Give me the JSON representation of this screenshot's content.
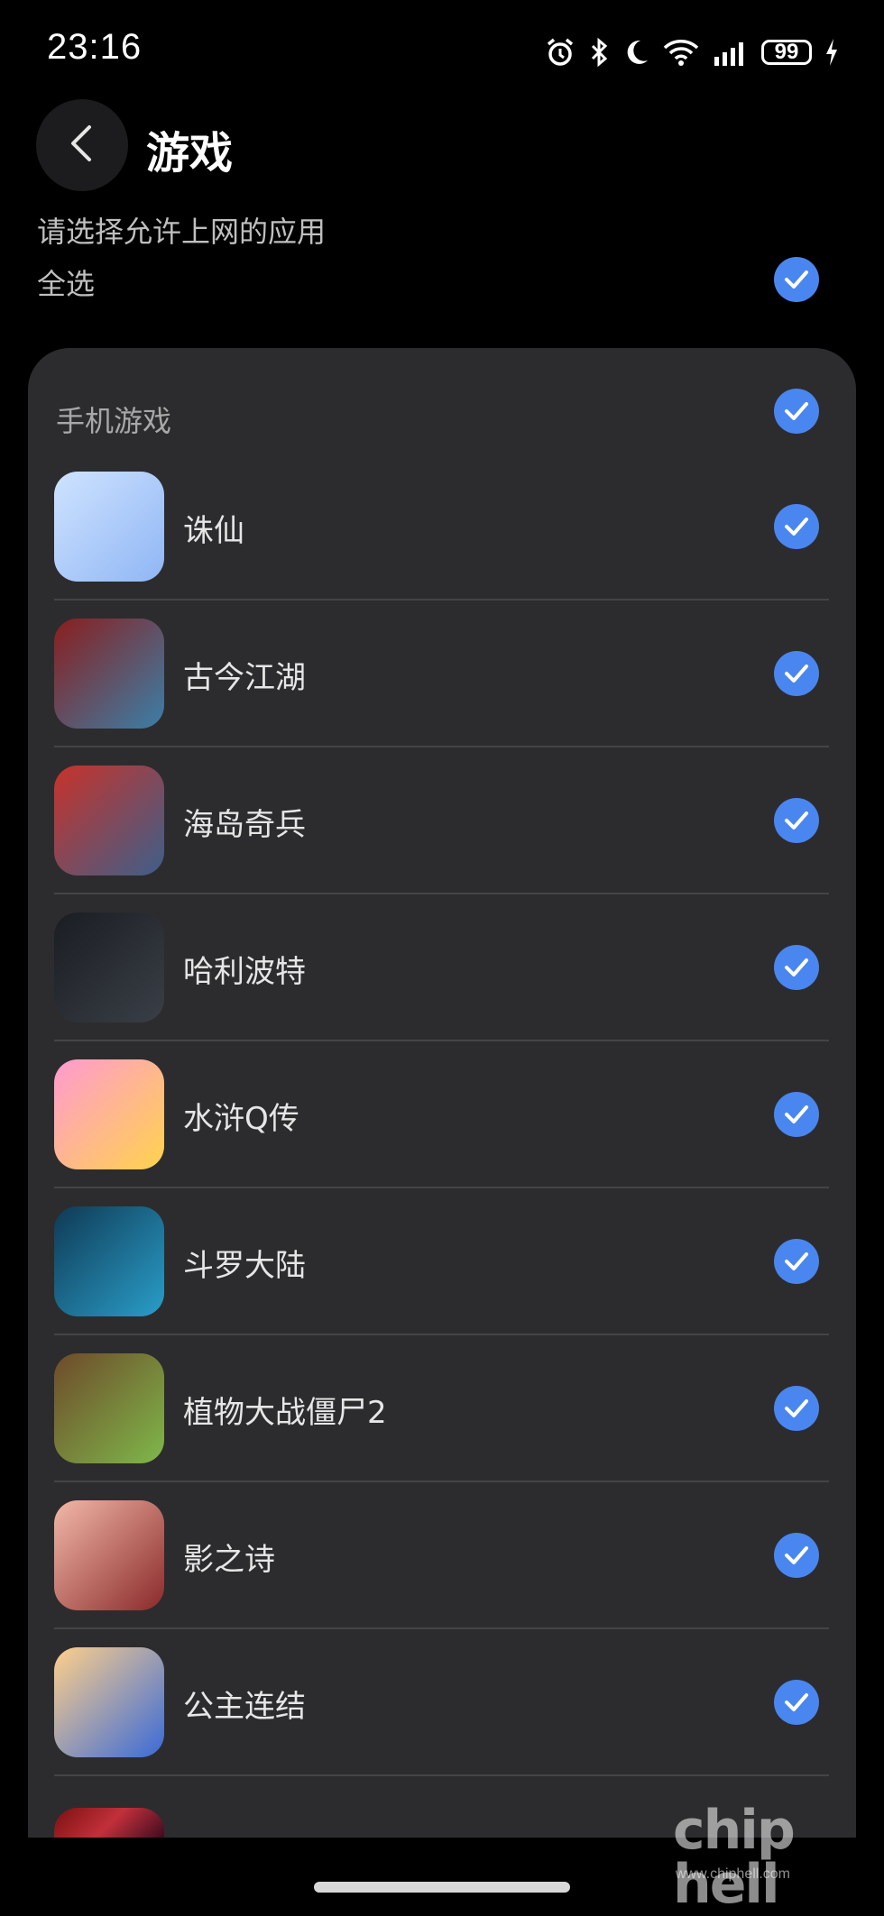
{
  "status_bar": {
    "time": "23:16",
    "battery": "99",
    "icons": [
      "alarm-icon",
      "bluetooth-icon",
      "moon-icon",
      "wifi-icon",
      "signal-icon",
      "battery-icon",
      "charging-icon"
    ]
  },
  "header": {
    "back_icon": "chevron-left-icon",
    "title": "游戏"
  },
  "subtitle": "请选择允许上网的应用",
  "select_all": {
    "label": "全选",
    "checked": true
  },
  "section": {
    "title": "手机游戏",
    "checked": true,
    "apps": [
      {
        "name": "诛仙",
        "checked": true,
        "icon": "zhuxian-icon",
        "colors": [
          "#cfe3ff",
          "#8fb6f5"
        ]
      },
      {
        "name": "古今江湖",
        "checked": true,
        "icon": "gujinjianghu-icon",
        "colors": [
          "#8a1e1e",
          "#3b7fa8"
        ]
      },
      {
        "name": "海岛奇兵",
        "checked": true,
        "icon": "boom-beach-icon",
        "colors": [
          "#c8322a",
          "#3d5f8a"
        ]
      },
      {
        "name": "哈利波特",
        "checked": true,
        "icon": "harry-potter-icon",
        "colors": [
          "#1a1d22",
          "#3a3f47"
        ]
      },
      {
        "name": "水浒Q传",
        "checked": true,
        "icon": "shuihu-q-icon",
        "colors": [
          "#ff9ad1",
          "#ffd34d"
        ]
      },
      {
        "name": "斗罗大陆",
        "checked": true,
        "icon": "douluo-icon",
        "colors": [
          "#0f3a55",
          "#2a9ec9"
        ]
      },
      {
        "name": "植物大战僵尸2",
        "checked": true,
        "icon": "pvz2-icon",
        "colors": [
          "#6e4a2a",
          "#7fb84a"
        ]
      },
      {
        "name": "影之诗",
        "checked": true,
        "icon": "shadowverse-icon",
        "colors": [
          "#f2b8a8",
          "#8a2a2a"
        ]
      },
      {
        "name": "公主连结",
        "checked": true,
        "icon": "princess-connect-icon",
        "colors": [
          "#ffd08a",
          "#3a6ad8"
        ]
      }
    ]
  },
  "watermark": {
    "logo": "chip hell",
    "url": "www.chiphell.com"
  },
  "accent_color": "#4a86f0"
}
